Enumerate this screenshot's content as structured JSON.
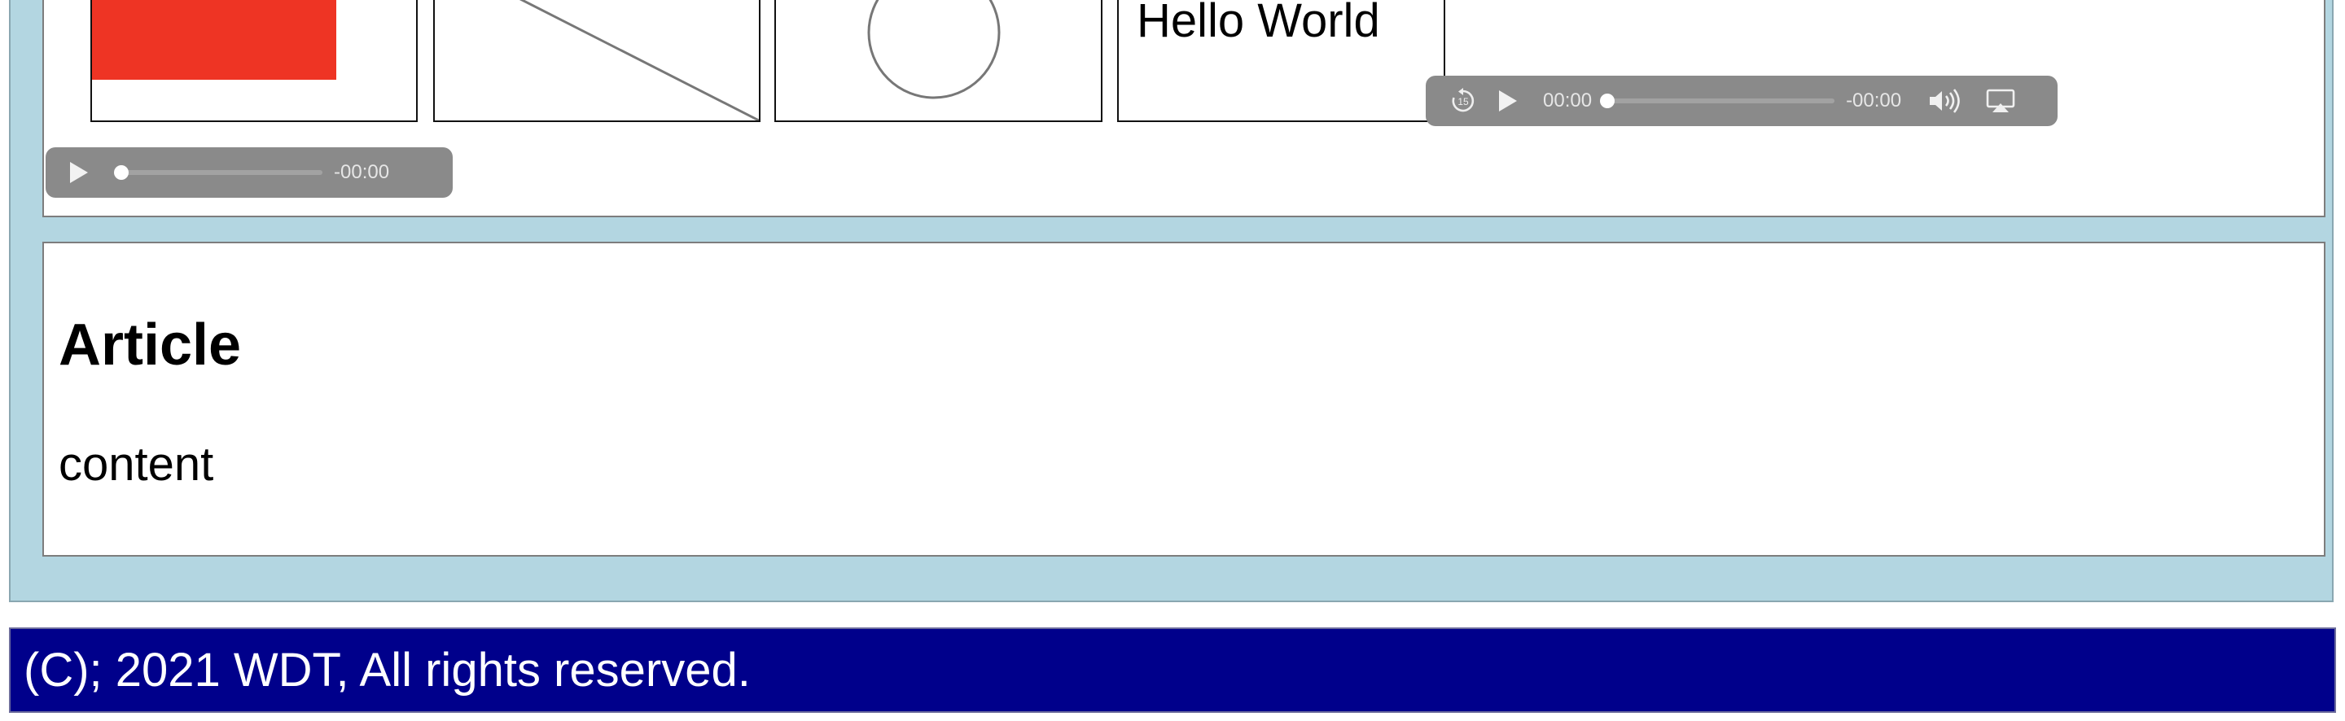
{
  "media": {
    "canvas_text": "Hello World",
    "image_fill_color": "#ee3424",
    "video_player": {
      "skip_back_label": "15",
      "current_time": "00:00",
      "remaining_time": "-00:00",
      "progress": 0,
      "background": "#8a8a8a"
    },
    "audio_player": {
      "remaining_time": "-00:00",
      "progress": 0,
      "background": "#8a8a8a"
    }
  },
  "article": {
    "title": "Article",
    "content": "content"
  },
  "footer": {
    "text": "(C); 2021 WDT, All rights reserved.",
    "background": "#00008b"
  },
  "colors": {
    "page_background": "#b3d6e1",
    "panel_background": "#ffffff"
  }
}
